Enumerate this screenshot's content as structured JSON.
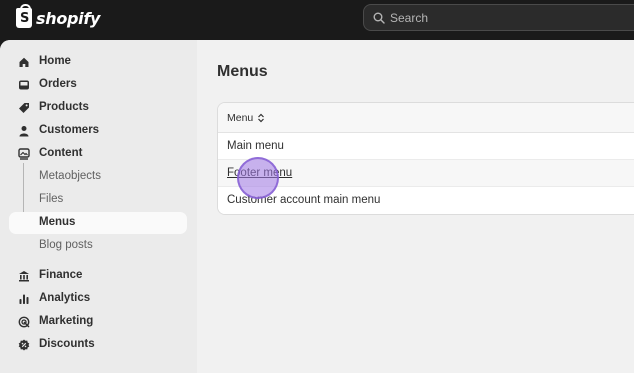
{
  "topbar": {
    "logo_text": "shopify",
    "search_placeholder": "Search"
  },
  "sidebar": {
    "items": [
      {
        "label": "Home",
        "icon": "home-icon"
      },
      {
        "label": "Orders",
        "icon": "inbox-icon"
      },
      {
        "label": "Products",
        "icon": "tag-icon"
      },
      {
        "label": "Customers",
        "icon": "person-icon"
      },
      {
        "label": "Content",
        "icon": "content-icon"
      },
      {
        "label": "Metaobjects"
      },
      {
        "label": "Files"
      },
      {
        "label": "Menus"
      },
      {
        "label": "Blog posts"
      },
      {
        "label": "Finance",
        "icon": "bank-icon"
      },
      {
        "label": "Analytics",
        "icon": "bar-chart-icon"
      },
      {
        "label": "Marketing",
        "icon": "target-icon"
      },
      {
        "label": "Discounts",
        "icon": "discount-icon"
      }
    ],
    "active": "Menus"
  },
  "main": {
    "title": "Menus",
    "table": {
      "column_header": "Menu",
      "rows": [
        "Main menu",
        "Footer menu",
        "Customer account main menu"
      ]
    }
  },
  "colors": {
    "topbar": "#1a1a1a",
    "app_bg": "#f1f1f1",
    "sidebar_bg": "#ebebeb",
    "cursor": "#a078e6"
  }
}
